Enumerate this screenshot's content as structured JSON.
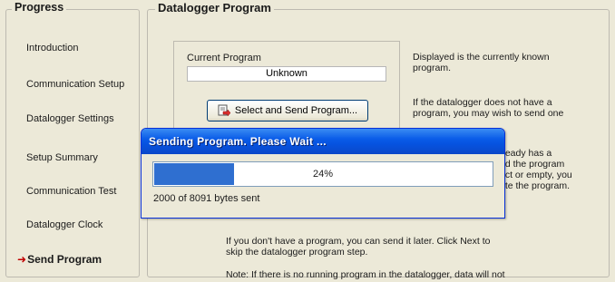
{
  "progress_panel": {
    "title": "Progress",
    "steps": [
      {
        "label": "Introduction"
      },
      {
        "label": "Communication Setup"
      },
      {
        "label": "Datalogger Settings"
      },
      {
        "label": "Setup Summary"
      },
      {
        "label": "Communication Test"
      },
      {
        "label": "Datalogger Clock"
      },
      {
        "label": "Send Program",
        "current": true
      }
    ]
  },
  "main": {
    "title": "Datalogger Program",
    "current_program_label": "Current Program",
    "current_program_value": "Unknown",
    "select_button_label": "Select and Send Program...",
    "select_button_icon": "send-program-icon",
    "desc1": [
      "Displayed is the currently known",
      "program."
    ],
    "desc2": [
      "If the datalogger does not have a",
      "program, you may wish to send one"
    ],
    "desc3": [
      "lready has a",
      "nd the program",
      "ect or empty, you",
      "ate the program."
    ],
    "info_lines": [
      "If you don't have a program, you can send it later.  Click Next to",
      "skip the datalogger program step."
    ],
    "note_line": "Note: If there is no running program in the datalogger, data will not"
  },
  "dialog": {
    "title": "Sending Program.  Please Wait ...",
    "progress_percent": 24,
    "progress_text": "24%",
    "bytes_text": "2000 of 8091 bytes sent",
    "fill_color": "#2f6fd0"
  }
}
